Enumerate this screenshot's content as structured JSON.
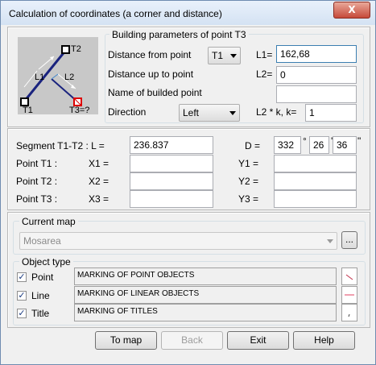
{
  "window": {
    "title": "Calculation of coordinates (a corner and distance)",
    "close_glyph": "X"
  },
  "diagram": {
    "label_t2": "T2",
    "label_t1": "T1",
    "label_t3": "T3=?",
    "label_l1": "L1",
    "label_l2": "L2"
  },
  "params": {
    "group_title": "Building parameters of point T3",
    "distance_from_label": "Distance from point",
    "distance_from_value": "T1",
    "l1_label": "L1=",
    "l1_value": "162,68",
    "distance_upto_label": "Distance  up to point",
    "l2_label": "L2=",
    "l2_value": "0",
    "name_label": "Name of builded point",
    "name_value": "",
    "direction_label": "Direction",
    "direction_value": "Left",
    "k_label": "L2 * k, k=",
    "k_value": "1"
  },
  "segment": {
    "segment_label": "Segment T1-T2 : L =",
    "segment_value": "236.837",
    "d_label": "D =",
    "deg": "332",
    "deg_sym": "°",
    "min": "26",
    "min_sym": "'",
    "sec": "36",
    "sec_sym": "\"",
    "rows": [
      {
        "point": "Point T1 :",
        "x_label": "X1 =",
        "x_value": "",
        "y_label": "Y1 =",
        "y_value": ""
      },
      {
        "point": "Point T2 :",
        "x_label": "X2 =",
        "x_value": "",
        "y_label": "Y2 =",
        "y_value": ""
      },
      {
        "point": "Point T3 :",
        "x_label": "X3 =",
        "x_value": "",
        "y_label": "Y3 =",
        "y_value": ""
      }
    ]
  },
  "map": {
    "group_title": "Current map",
    "value": "Mosarea",
    "browse_label": "..."
  },
  "objects": {
    "group_title": "Object type",
    "items": [
      {
        "label": "Point",
        "checked": true,
        "text": "MARKING OF POINT OBJECTS",
        "side_color": "#c0304a"
      },
      {
        "label": "Line",
        "checked": true,
        "text": "MARKING OF LINEAR OBJECTS",
        "side_color": "#e04060"
      },
      {
        "label": "Title",
        "checked": true,
        "text": "MARKING OF TITLES",
        "side_color": "#404040"
      }
    ]
  },
  "buttons": {
    "to_map": "To map",
    "back": "Back",
    "exit": "Exit",
    "help": "Help"
  }
}
